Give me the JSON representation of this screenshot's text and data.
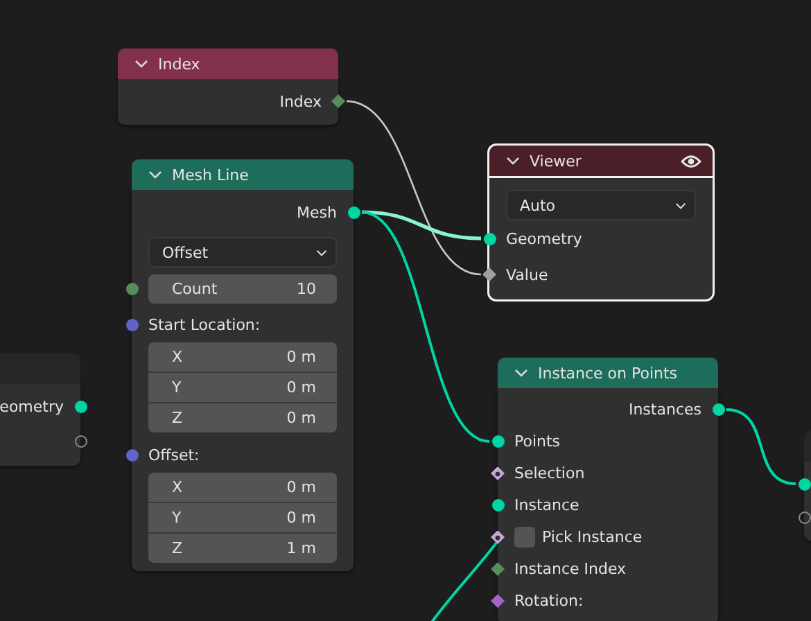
{
  "nodes": [
    {
      "kind": "input",
      "title": "Index",
      "selected": false,
      "rows": [
        {
          "kind": "output",
          "label": "Index",
          "socket": {
            "kind": "diamond",
            "color": "#598c5c"
          }
        }
      ]
    },
    {
      "kind": "geometry",
      "title": "Mesh Line",
      "selected": false,
      "rows": [
        {
          "kind": "output",
          "label": "Mesh",
          "socket": {
            "kind": "circle",
            "color": "#00d6a3"
          }
        },
        {
          "kind": "dropdown",
          "value": "Offset"
        },
        {
          "kind": "number",
          "label": "Count",
          "value": "10",
          "socket": {
            "kind": "circle",
            "color": "#598c5c"
          }
        },
        {
          "kind": "vector",
          "label": "Start Location:",
          "socket": {
            "kind": "circle",
            "color": "#6363c7"
          },
          "fields": [
            {
              "label": "X",
              "value": "0 m"
            },
            {
              "label": "Y",
              "value": "0 m"
            },
            {
              "label": "Z",
              "value": "0 m"
            }
          ]
        },
        {
          "kind": "vector",
          "label": "Offset:",
          "socket": {
            "kind": "circle",
            "color": "#6363c7"
          },
          "fields": [
            {
              "label": "X",
              "value": "0 m"
            },
            {
              "label": "Y",
              "value": "0 m"
            },
            {
              "label": "Z",
              "value": "1 m"
            }
          ]
        }
      ]
    },
    {
      "kind": "output",
      "title": "Viewer",
      "selected": true,
      "rows": [
        {
          "kind": "dropdown",
          "value": "Auto"
        },
        {
          "kind": "input",
          "label": "Geometry",
          "socket": {
            "kind": "circle",
            "color": "#00d6a3"
          }
        },
        {
          "kind": "input",
          "label": "Value",
          "socket": {
            "kind": "diamond",
            "color": "#a1a1a1"
          }
        }
      ]
    },
    {
      "kind": "other",
      "selected": false,
      "rows": [
        {
          "kind": "output",
          "label": "eometry",
          "socket": {
            "kind": "circle",
            "color": "#00d6a3"
          }
        },
        {
          "kind": "empty-output",
          "socket": {
            "kind": "hollow",
            "color": "#8a8a8a"
          }
        }
      ]
    },
    {
      "kind": "geometry",
      "title": "Instance on Points",
      "selected": false,
      "rows": [
        {
          "kind": "output",
          "label": "Instances",
          "socket": {
            "kind": "circle",
            "color": "#00d6a3"
          }
        },
        {
          "kind": "input",
          "label": "Points",
          "socket": {
            "kind": "circle",
            "color": "#00d6a3"
          }
        },
        {
          "kind": "input",
          "label": "Selection",
          "socket": {
            "kind": "dotted-diamond",
            "color": "#cca6d6"
          }
        },
        {
          "kind": "input",
          "label": "Instance",
          "socket": {
            "kind": "circle",
            "color": "#00d6a3"
          }
        },
        {
          "kind": "checkbox",
          "label": "Pick Instance",
          "socket": {
            "kind": "dotted-diamond",
            "color": "#cca6d6"
          },
          "checked": false
        },
        {
          "kind": "input",
          "label": "Instance Index",
          "socket": {
            "kind": "diamond",
            "color": "#598c5c"
          }
        },
        {
          "kind": "input",
          "label": "Rotation:",
          "socket": {
            "kind": "diamond",
            "color": "#a663c7"
          }
        }
      ]
    },
    {
      "kind": "other",
      "selected": false,
      "rows": [
        {
          "kind": "empty-input",
          "socket": {
            "kind": "circle",
            "color": "#00d6a3"
          }
        },
        {
          "kind": "empty-input",
          "socket": {
            "kind": "hollow",
            "color": "#8a8a8a"
          }
        }
      ]
    }
  ]
}
